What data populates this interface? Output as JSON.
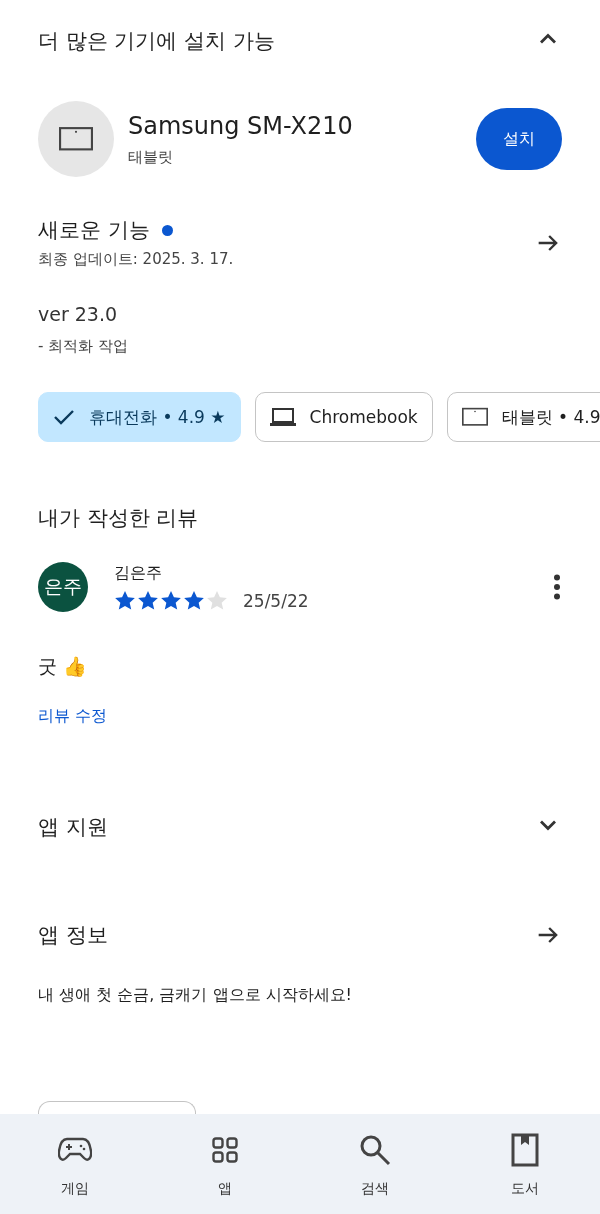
{
  "install_section": {
    "title": "더 많은 기기에 설치 가능",
    "expanded": true,
    "device": {
      "name": "Samsung SM-X210",
      "type": "태블릿",
      "button": "설치"
    }
  },
  "whats_new": {
    "title": "새로운 기능",
    "unread": true,
    "updated": "최종 업데이트: 2025. 3. 17.",
    "version": "ver 23.0",
    "notes": "- 최적화 작업"
  },
  "device_chips": [
    {
      "kind": "phone",
      "label": "휴대전화 • 4.9 ★",
      "selected": true
    },
    {
      "kind": "laptop",
      "label": "Chromebook",
      "selected": false
    },
    {
      "kind": "tablet",
      "label": "태블릿 • 4.9",
      "selected": false
    }
  ],
  "my_review": {
    "title": "내가 작성한 리뷰",
    "avatar": "은주",
    "author": "김은주",
    "stars": 4,
    "date": "25/5/22",
    "text": "굿 👍",
    "edit_link": "리뷰 수정"
  },
  "app_support": {
    "title": "앱 지원",
    "expanded": false
  },
  "app_info": {
    "title": "앱 정보",
    "description": "내 생애 첫 순금, 금캐기 앱으로 시작하세요!"
  },
  "bottom_nav": [
    {
      "kind": "games",
      "label": "게임"
    },
    {
      "kind": "apps",
      "label": "앱"
    },
    {
      "kind": "search",
      "label": "검색"
    },
    {
      "kind": "books",
      "label": "도서"
    }
  ]
}
